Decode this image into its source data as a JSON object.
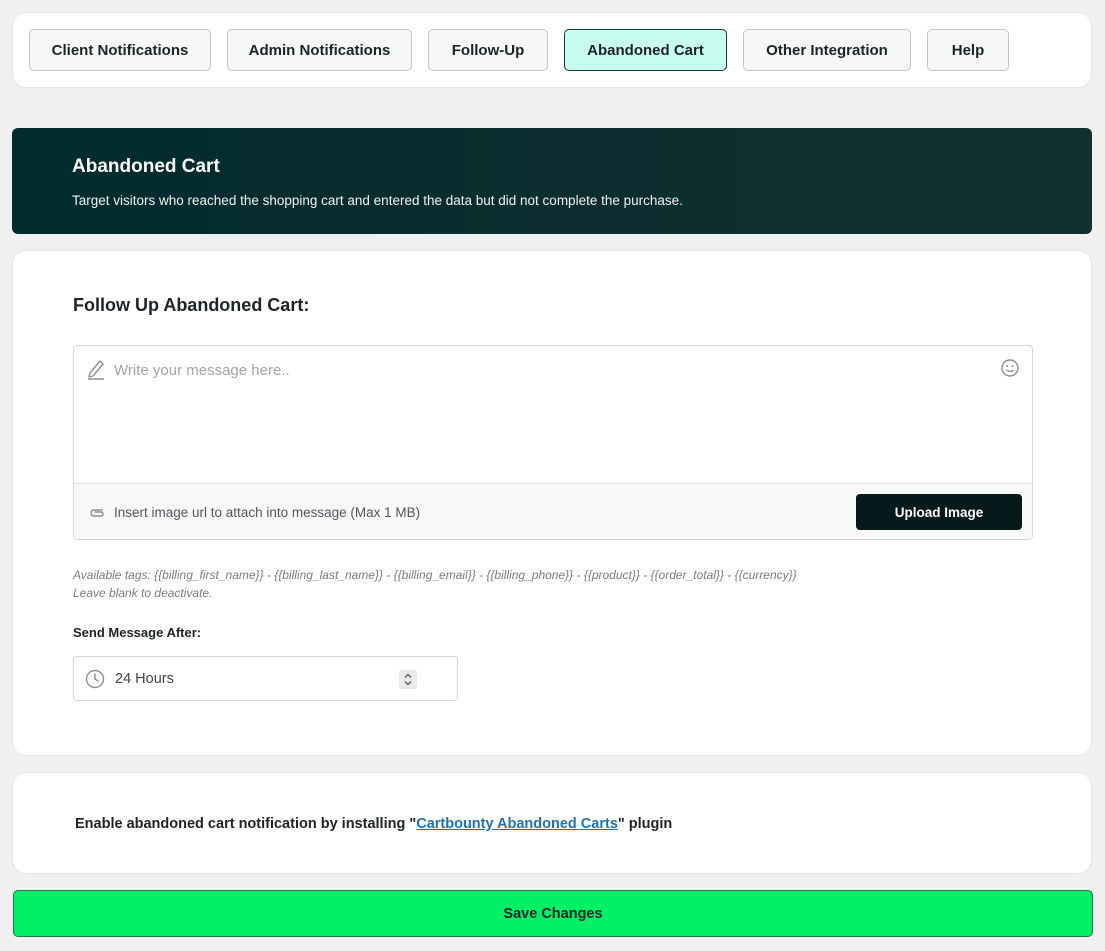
{
  "tabs": [
    {
      "label": "Client Notifications",
      "active": false
    },
    {
      "label": "Admin Notifications",
      "active": false
    },
    {
      "label": "Follow-Up",
      "active": false
    },
    {
      "label": "Abandoned Cart",
      "active": true
    },
    {
      "label": "Other Integration",
      "active": false
    },
    {
      "label": "Help",
      "active": false
    }
  ],
  "hero": {
    "title": "Abandoned Cart",
    "description": "Target visitors who reached the shopping cart and entered the data but did not complete the purchase."
  },
  "followup": {
    "title": "Follow Up Abandoned Cart:",
    "message_placeholder": "Write your message here..",
    "message_value": "",
    "attach_placeholder": "Insert image url to attach into message (Max 1 MB)",
    "upload_label": "Upload Image",
    "tags_hint": "Available tags: {{billing_first_name}} - {{billing_last_name}} - {{billing_email}} - {{billing_phone}} - {{product}} - {{order_total}} - {{currency}}",
    "blank_hint": "Leave blank to deactivate.",
    "send_after_label": "Send Message After:",
    "send_after_value": "24 Hours"
  },
  "plugin_notice": {
    "prefix": "Enable abandoned cart notification by installing \"",
    "link_text": "Cartbounty Abandoned Carts",
    "suffix": "\" plugin"
  },
  "save_label": "Save Changes",
  "colors": {
    "accent_tab": "#c8fcee",
    "hero_bg": "#012c2d",
    "save_bg": "#00ef67",
    "upload_bg": "#06191b",
    "link": "#2271b1"
  }
}
